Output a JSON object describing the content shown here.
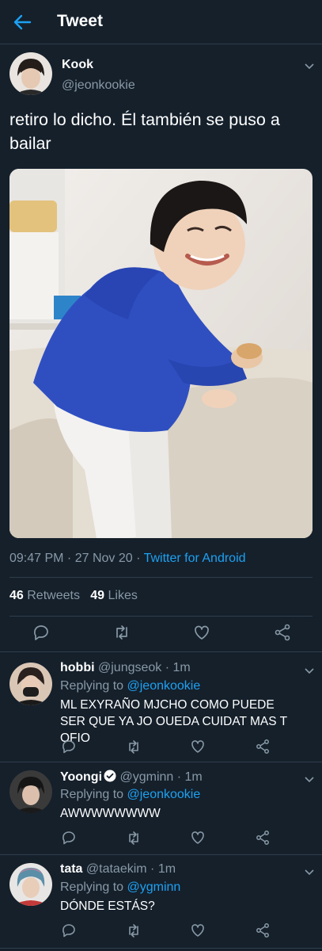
{
  "header": {
    "title": "Tweet"
  },
  "tweet": {
    "name": "Kook",
    "handle": "@jeonkookie",
    "text": "retiro lo dicho. Él también se puso a bailar",
    "time": "09:47 PM · 27 Nov 20 · ",
    "source": "Twitter for Android",
    "retweets_count": "46",
    "retweets_label": " Retweets",
    "likes_count": "49",
    "likes_label": " Likes"
  },
  "replies": [
    {
      "name": "hobbi",
      "handle": " @jungseok · 1m",
      "replying_prefix": "Replying to ",
      "replying_to": "@jeonkookie",
      "text": "ML EXYRAÑO MJCHO COMO PUEDE SER QUE YA JO OUEDA CUIDAT MAS T OFIO",
      "verified": false
    },
    {
      "name": "Yoongi",
      "handle": " @ygminn · 1m",
      "replying_prefix": "Replying to ",
      "replying_to": "@jeonkookie",
      "text": "AWWWWWWWW",
      "verified": true
    },
    {
      "name": "tata",
      "handle": " @tataekim · 1m",
      "replying_prefix": "Replying to ",
      "replying_to": "@ygminn",
      "text": "DÓNDE ESTÁS?",
      "verified": false
    }
  ],
  "colors": {
    "background": "#15202b",
    "text_secondary": "#8899a6",
    "accent": "#1da1f2",
    "divider": "#2f3d4b"
  },
  "icons": [
    "back-arrow-icon",
    "chevron-down-icon",
    "reply-icon",
    "retweet-icon",
    "like-icon",
    "share-icon",
    "verified-badge-icon"
  ]
}
